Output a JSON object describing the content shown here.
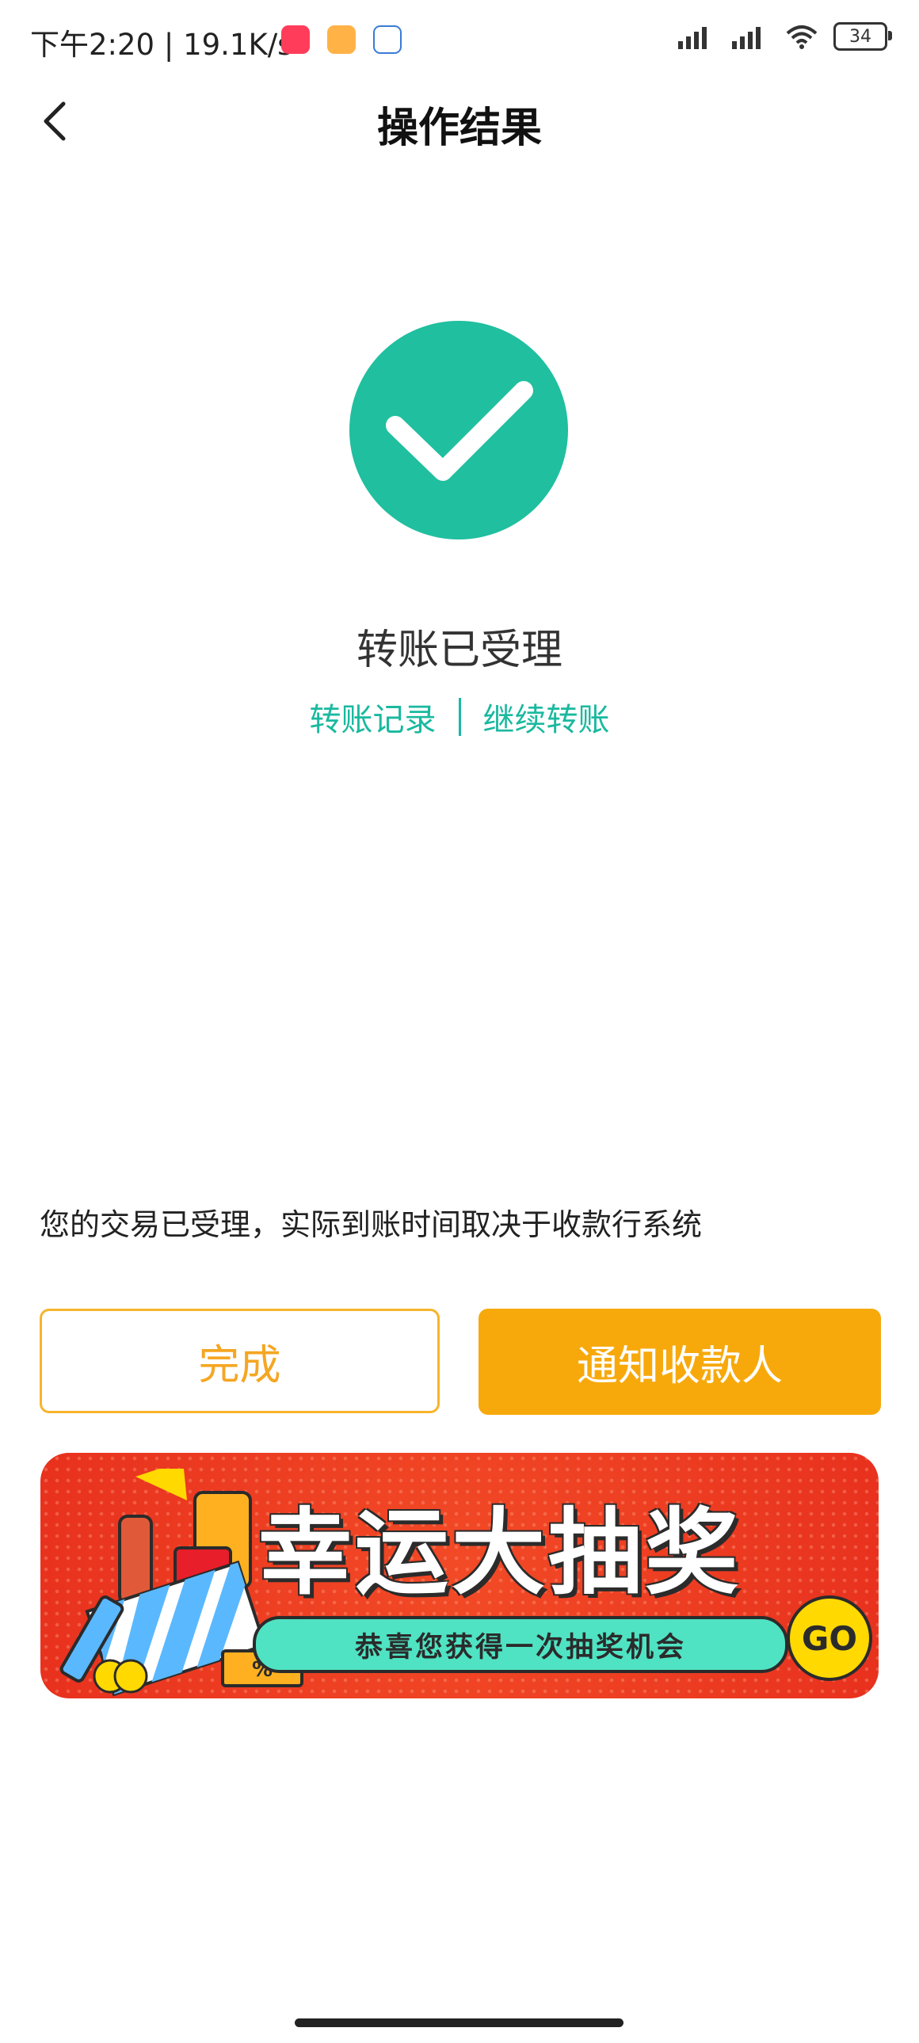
{
  "status_bar": {
    "time": "下午2:20 | 19.1K/s",
    "battery": "34"
  },
  "nav": {
    "title": "操作结果"
  },
  "result": {
    "title": "转账已受理",
    "link_records": "转账记录",
    "link_continue": "继续转账"
  },
  "notice": "您的交易已受理，实际到账时间取决于收款行系统",
  "buttons": {
    "done": "完成",
    "notify": "通知收款人"
  },
  "banner": {
    "title": "幸运大抽奖",
    "subtitle": "恭喜您获得一次抽奖机会",
    "go": "GO"
  },
  "colors": {
    "accent_teal": "#1ab99f",
    "accent_orange": "#f7a90c",
    "success_green": "#1fbf9f"
  }
}
